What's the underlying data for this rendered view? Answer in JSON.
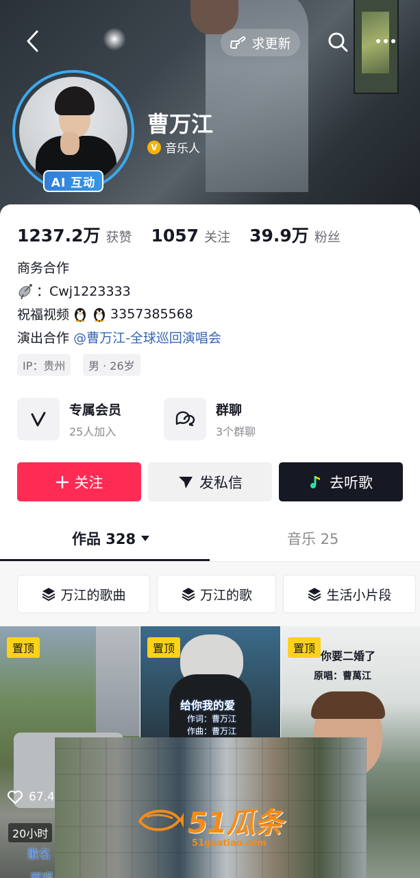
{
  "header": {
    "update_label": "求更新"
  },
  "profile": {
    "name": "曹万江",
    "ai_badge": "AI 互动",
    "verified_label": "音乐人",
    "verified_mark": "V"
  },
  "stats": [
    {
      "value": "1237.2万",
      "label": "获赞"
    },
    {
      "value": "1057",
      "label": "关注"
    },
    {
      "value": "39.9万",
      "label": "粉丝"
    }
  ],
  "bio": {
    "line1": "商务合作",
    "line2_prefix": "：Cwj1223333",
    "line3_prefix": "祝福视频",
    "line3_number": "3357385568",
    "line4_prefix": "演出合作",
    "line4_link": "@曹万江-全球巡回演唱会"
  },
  "tags": [
    "IP：贵州",
    "男 · 26岁"
  ],
  "features": [
    {
      "title": "专属会员",
      "subtitle": "25人加入"
    },
    {
      "title": "群聊",
      "subtitle": "3个群聊"
    }
  ],
  "actions": {
    "follow": "关注",
    "message": "发私信",
    "listen": "去听歌"
  },
  "tabs": {
    "works": "作品 328",
    "music": "音乐 25"
  },
  "chips": [
    "万江的歌曲",
    "万江的歌",
    "生活小片段"
  ],
  "videos": [
    {
      "pin": "置顶",
      "likes": "67.4",
      "time": "20小时",
      "caption1": "歌名",
      "caption2": "原唱"
    },
    {
      "pin": "置顶",
      "overlay1": "给你我的爱",
      "overlay2": "作词：曹万江",
      "overlay3": "作曲：曹万江"
    },
    {
      "pin": "置顶",
      "overlay1": "你要二婚了",
      "overlay2": "原唱：曹萬江"
    }
  ],
  "watermark": {
    "brand": "51瓜条",
    "url": "51guatiao.com"
  }
}
